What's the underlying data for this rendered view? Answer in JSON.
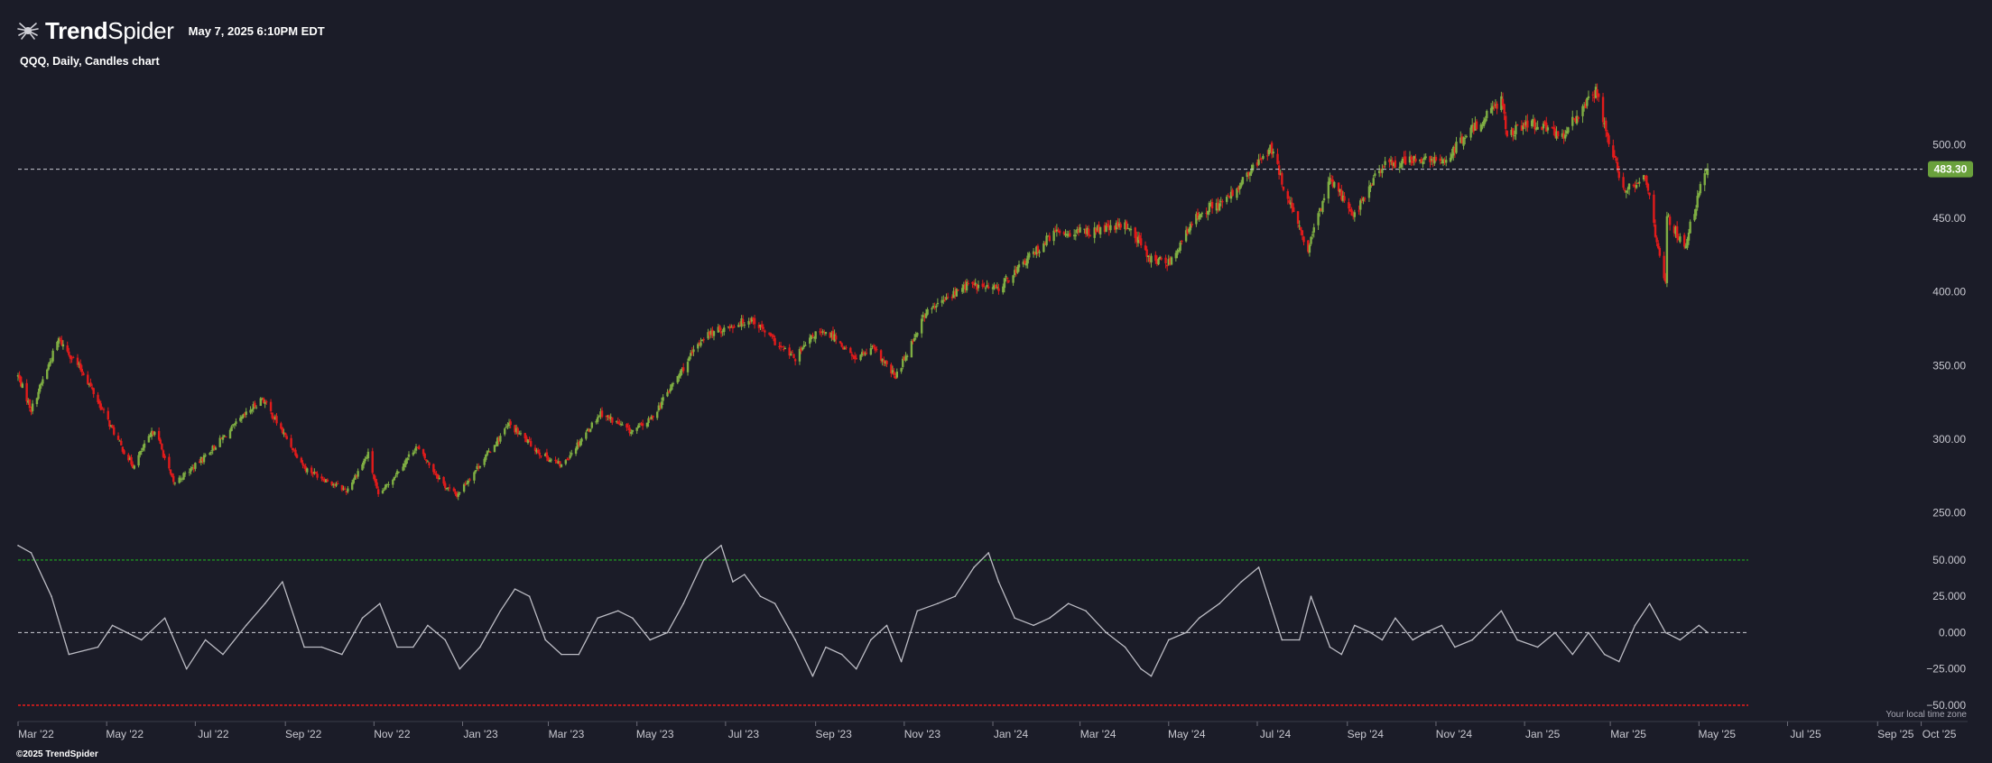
{
  "brand": {
    "name_bold": "Trend",
    "name_thin": "Spider"
  },
  "timestamp": "May 7, 2025 6:10PM EDT",
  "subtitle": "QQQ, Daily, Candles chart",
  "footer": "©2025 TrendSpider",
  "timezone_note": "Your local time zone",
  "colors": {
    "background": "#1b1c28",
    "up": "#7fae43",
    "down": "#e11b1b",
    "osc_line": "#bcbcc4",
    "overbought": "#1fa81f",
    "oversold": "#e11b1b",
    "price_tag": "#6aa13c"
  },
  "chart_data": [
    {
      "type": "candlestick",
      "symbol": "QQQ",
      "interval": "Daily",
      "ylim": [
        240,
        540
      ],
      "yticks": [
        "250.00",
        "300.00",
        "350.00",
        "400.00",
        "450.00",
        "500.00"
      ],
      "last_price": "483.30",
      "last_price_value": 483.3,
      "xlim": [
        "2022-03-01",
        "2025-10-05"
      ],
      "xticks": [
        "Mar '22",
        "May '22",
        "Jul '22",
        "Sep '22",
        "Nov '22",
        "Jan '23",
        "Mar '23",
        "May '23",
        "Jul '23",
        "Sep '23",
        "Nov '23",
        "Jan '24",
        "Mar '24",
        "May '24",
        "Jul '24",
        "Sep '24",
        "Nov '24",
        "Jan '25",
        "Mar '25",
        "May '25",
        "Jul '25",
        "Sep '25",
        "Oct '25"
      ],
      "xtick_dates": [
        "2022-03-01",
        "2022-05-01",
        "2022-07-01",
        "2022-09-01",
        "2022-11-01",
        "2023-01-01",
        "2023-03-01",
        "2023-05-01",
        "2023-07-01",
        "2023-09-01",
        "2023-11-01",
        "2024-01-01",
        "2024-03-01",
        "2024-05-01",
        "2024-07-01",
        "2024-09-01",
        "2024-11-01",
        "2025-01-01",
        "2025-03-01",
        "2025-05-01",
        "2025-07-01",
        "2025-09-01",
        "2025-10-01"
      ],
      "close_path": {
        "dates": [
          "2022-03-01",
          "2022-03-10",
          "2022-03-29",
          "2022-04-15",
          "2022-05-11",
          "2022-05-19",
          "2022-06-03",
          "2022-06-16",
          "2022-07-01",
          "2022-08-16",
          "2022-08-30",
          "2022-09-15",
          "2022-10-13",
          "2022-10-28",
          "2022-11-04",
          "2022-11-30",
          "2022-12-20",
          "2022-12-28",
          "2023-02-02",
          "2023-02-24",
          "2023-03-10",
          "2023-04-06",
          "2023-04-27",
          "2023-05-10",
          "2023-06-16",
          "2023-07-19",
          "2023-08-08",
          "2023-08-18",
          "2023-09-01",
          "2023-09-14",
          "2023-09-27",
          "2023-10-11",
          "2023-10-26",
          "2023-11-15",
          "2023-12-14",
          "2024-01-04",
          "2024-02-12",
          "2024-03-07",
          "2024-04-03",
          "2024-04-19",
          "2024-05-01",
          "2024-05-23",
          "2024-06-10",
          "2024-07-10",
          "2024-07-25",
          "2024-08-05",
          "2024-08-20",
          "2024-09-06",
          "2024-09-24",
          "2024-10-15",
          "2024-11-05",
          "2024-12-16",
          "2024-12-20",
          "2025-01-06",
          "2025-01-27",
          "2025-02-19",
          "2025-03-10",
          "2025-03-25",
          "2025-04-04",
          "2025-04-08",
          "2025-04-09",
          "2025-04-21",
          "2025-05-02",
          "2025-05-07"
        ],
        "values": [
          343,
          320,
          368,
          345,
          295,
          282,
          307,
          270,
          282,
          328,
          305,
          280,
          265,
          290,
          261,
          295,
          268,
          262,
          310,
          290,
          282,
          318,
          305,
          313,
          370,
          382,
          362,
          355,
          372,
          370,
          355,
          361,
          342,
          385,
          405,
          402,
          440,
          441,
          445,
          422,
          420,
          455,
          462,
          498,
          455,
          428,
          478,
          452,
          485,
          490,
          488,
          531,
          508,
          514,
          506,
          536,
          468,
          480,
          423,
          405,
          452,
          430,
          470,
          483.3
        ]
      }
    },
    {
      "type": "line",
      "name": "",
      "ylim": [
        -60,
        63
      ],
      "yticks": [
        "50.000",
        "25.000",
        "0.000",
        "−25.000",
        "−50.000"
      ],
      "levels": {
        "overbought": 50,
        "zero": 0,
        "oversold": -50
      },
      "points": {
        "dates": [
          "2022-03-01",
          "2022-03-10",
          "2022-03-24",
          "2022-04-05",
          "2022-04-25",
          "2022-05-05",
          "2022-05-25",
          "2022-06-10",
          "2022-06-25",
          "2022-07-08",
          "2022-07-20",
          "2022-08-05",
          "2022-08-18",
          "2022-08-30",
          "2022-09-14",
          "2022-09-26",
          "2022-10-10",
          "2022-10-24",
          "2022-11-05",
          "2022-11-17",
          "2022-11-28",
          "2022-12-08",
          "2022-12-20",
          "2022-12-30",
          "2023-01-13",
          "2023-01-27",
          "2023-02-06",
          "2023-02-16",
          "2023-02-27",
          "2023-03-10",
          "2023-03-22",
          "2023-04-04",
          "2023-04-18",
          "2023-04-28",
          "2023-05-10",
          "2023-05-22",
          "2023-06-02",
          "2023-06-16",
          "2023-06-28",
          "2023-07-06",
          "2023-07-14",
          "2023-07-25",
          "2023-08-04",
          "2023-08-18",
          "2023-08-30",
          "2023-09-08",
          "2023-09-19",
          "2023-09-29",
          "2023-10-09",
          "2023-10-20",
          "2023-10-30",
          "2023-11-10",
          "2023-11-24",
          "2023-12-06",
          "2023-12-19",
          "2023-12-29",
          "2024-01-05",
          "2024-01-16",
          "2024-01-29",
          "2024-02-09",
          "2024-02-22",
          "2024-03-05",
          "2024-03-19",
          "2024-04-01",
          "2024-04-12",
          "2024-04-19",
          "2024-05-01",
          "2024-05-13",
          "2024-05-22",
          "2024-06-05",
          "2024-06-20",
          "2024-07-02",
          "2024-07-10",
          "2024-07-18",
          "2024-07-30",
          "2024-08-07",
          "2024-08-20",
          "2024-08-28",
          "2024-09-06",
          "2024-09-17",
          "2024-09-25",
          "2024-10-04",
          "2024-10-16",
          "2024-10-25",
          "2024-11-05",
          "2024-11-14",
          "2024-11-26",
          "2024-12-06",
          "2024-12-16",
          "2024-12-27",
          "2025-01-10",
          "2025-01-22",
          "2025-02-03",
          "2025-02-14",
          "2025-02-25",
          "2025-03-07",
          "2025-03-18",
          "2025-03-28",
          "2025-04-08",
          "2025-04-18",
          "2025-05-01",
          "2025-05-07"
        ],
        "values": [
          60,
          55,
          25,
          -15,
          -10,
          5,
          -5,
          10,
          -25,
          -5,
          -15,
          5,
          20,
          35,
          -10,
          -10,
          -15,
          10,
          20,
          -10,
          -10,
          5,
          -5,
          -25,
          -10,
          15,
          30,
          25,
          -5,
          -15,
          -15,
          10,
          15,
          10,
          -5,
          0,
          20,
          50,
          60,
          35,
          40,
          25,
          20,
          -5,
          -30,
          -10,
          -15,
          -25,
          -5,
          5,
          -20,
          15,
          20,
          25,
          45,
          55,
          35,
          10,
          5,
          10,
          20,
          15,
          0,
          -10,
          -25,
          -30,
          -5,
          0,
          10,
          20,
          35,
          45,
          20,
          -5,
          -5,
          25,
          -10,
          -15,
          5,
          0,
          -5,
          10,
          -5,
          0,
          5,
          -10,
          -5,
          5,
          15,
          -5,
          -10,
          0,
          -15,
          0,
          -15,
          -20,
          5,
          20,
          0,
          -5,
          5,
          0
        ]
      }
    }
  ]
}
